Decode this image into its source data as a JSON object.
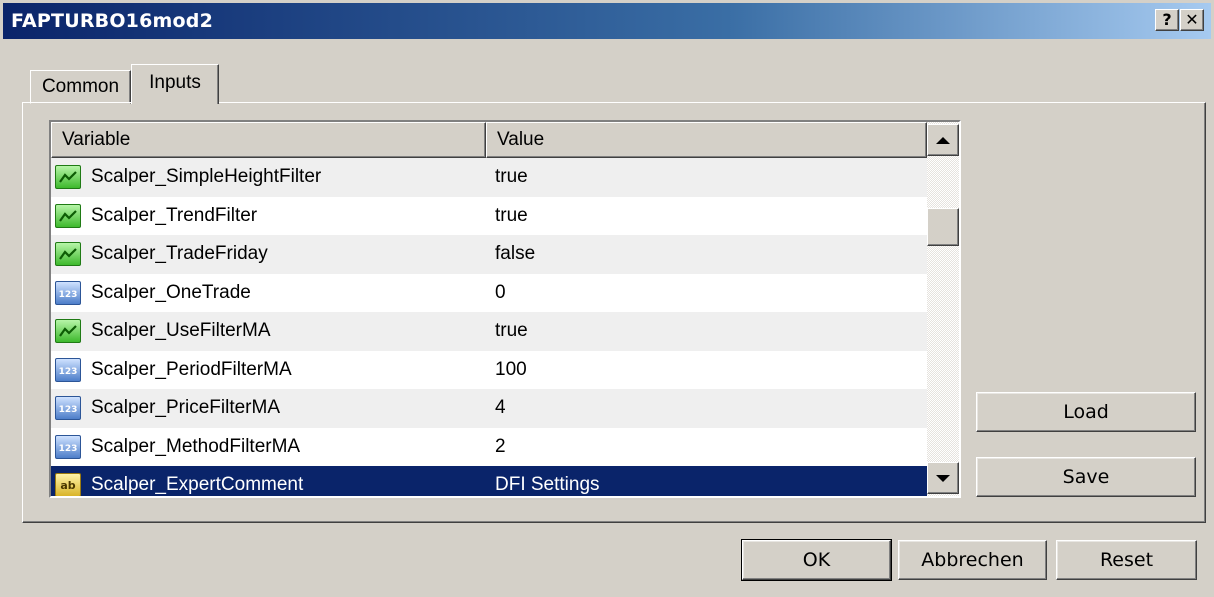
{
  "window": {
    "title": "FAPTURBO16mod2",
    "help_label": "?",
    "close_label": "✕"
  },
  "tabs": [
    {
      "label": "Common",
      "active": false
    },
    {
      "label": "Inputs",
      "active": true
    }
  ],
  "grid": {
    "columns": [
      "Variable",
      "Value"
    ],
    "rows": [
      {
        "variable": "Scalper_SimpleHeightFilter",
        "value": "true",
        "type": "bool-icon"
      },
      {
        "variable": "Scalper_TrendFilter",
        "value": "true",
        "type": "bool-icon"
      },
      {
        "variable": "Scalper_TradeFriday",
        "value": "false",
        "type": "bool-icon"
      },
      {
        "variable": "Scalper_OneTrade",
        "value": "0",
        "type": "number-icon"
      },
      {
        "variable": "Scalper_UseFilterMA",
        "value": "true",
        "type": "bool-icon"
      },
      {
        "variable": "Scalper_PeriodFilterMA",
        "value": "100",
        "type": "number-icon"
      },
      {
        "variable": "Scalper_PriceFilterMA",
        "value": "4",
        "type": "number-icon"
      },
      {
        "variable": "Scalper_MethodFilterMA",
        "value": "2",
        "type": "number-icon"
      },
      {
        "variable": "Scalper_ExpertComment",
        "value": "DFI Settings",
        "type": "string-icon",
        "selected": true
      }
    ]
  },
  "side_buttons": {
    "load": "Load",
    "save": "Save"
  },
  "footer_buttons": {
    "ok": "OK",
    "cancel": "Abbrechen",
    "reset": "Reset"
  }
}
